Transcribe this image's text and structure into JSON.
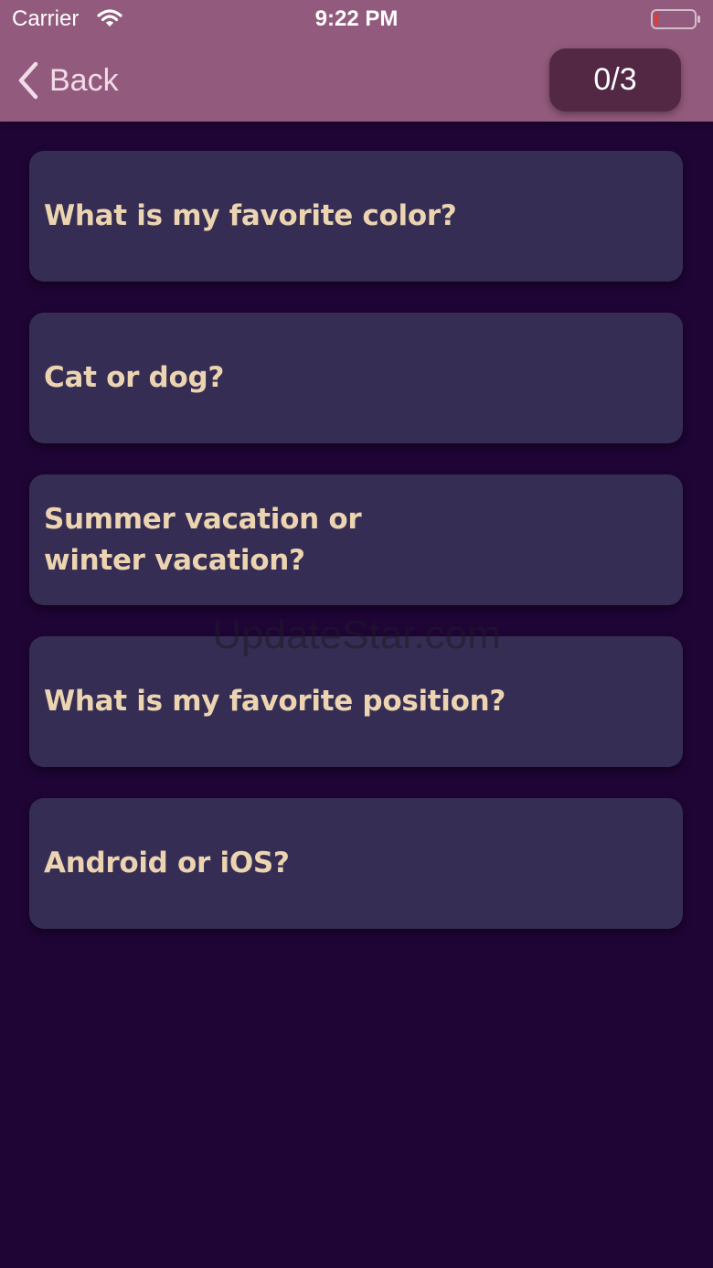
{
  "status_bar": {
    "carrier": "Carrier",
    "time": "9:22 PM",
    "wifi_icon": "wifi-icon",
    "battery_icon": "battery-low-icon",
    "battery_color": "#e53935"
  },
  "nav": {
    "back_label": "Back",
    "back_icon": "chevron-left-icon",
    "counter": "0/3"
  },
  "questions": [
    {
      "text": "What is my favorite color?"
    },
    {
      "text": "Cat or dog?"
    },
    {
      "text": "Summer vacation or\nwinter vacation?"
    },
    {
      "text": "What is my favorite position?"
    },
    {
      "text": "Android or iOS?"
    }
  ],
  "watermark": "UpdateStar.com",
  "colors": {
    "background": "#1f0536",
    "nav_bar": "#925a7c",
    "counter_badge": "#522845",
    "card": "#352d53",
    "question_text": "#ecd4b1"
  }
}
